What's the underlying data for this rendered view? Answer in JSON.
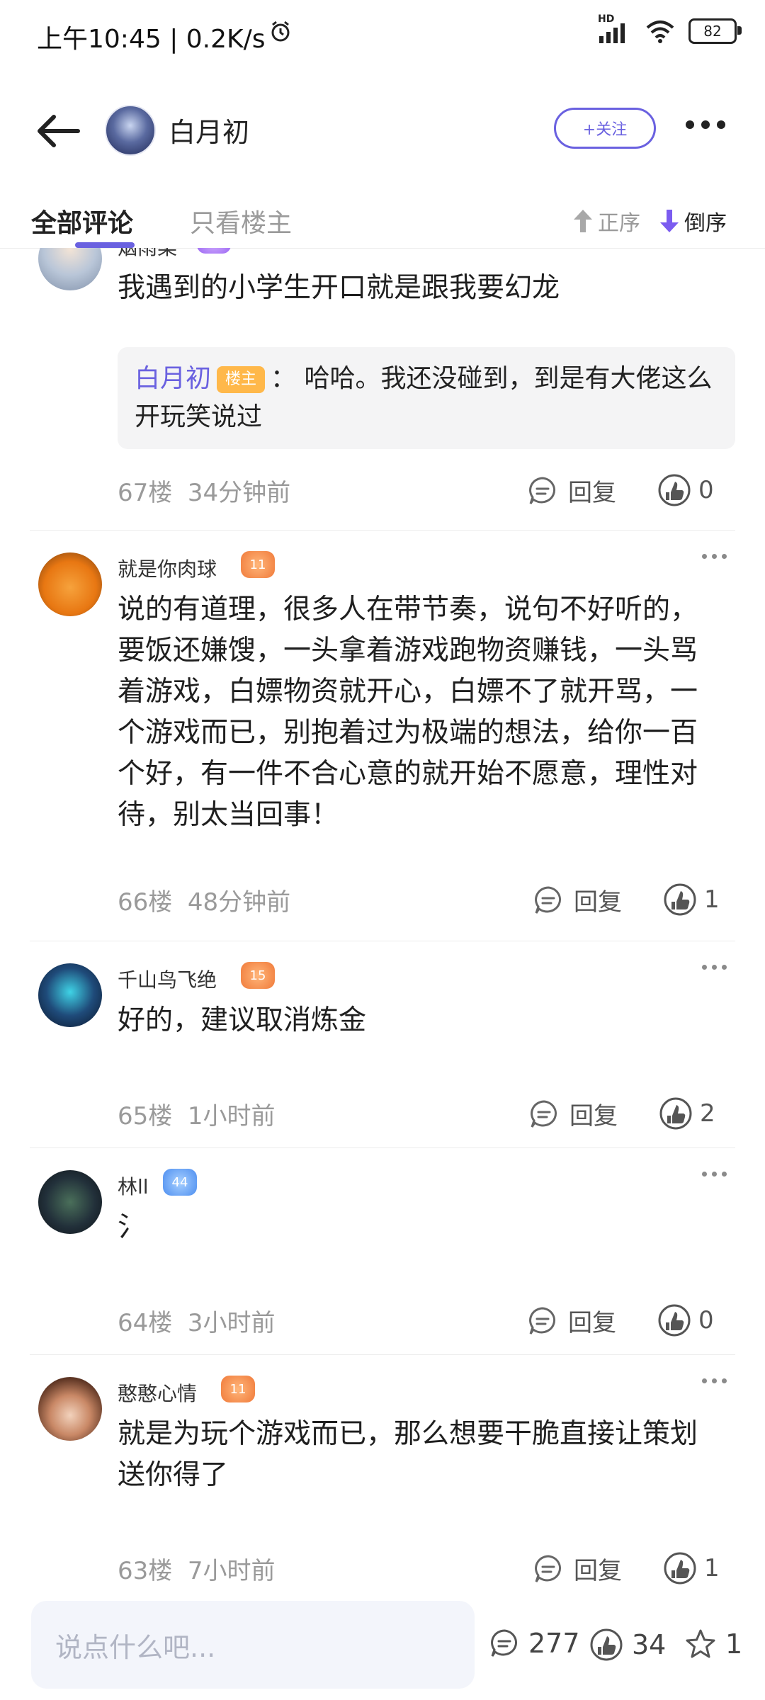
{
  "status_bar": {
    "time": "上午10:45 | 0.2K/s",
    "battery": "82",
    "network": "HD"
  },
  "header": {
    "username": "白月初",
    "follow_label": "+关注"
  },
  "tabs": {
    "all": "全部评论",
    "owner_only": "只看楼主",
    "sort_asc": "正序",
    "sort_desc": "倒序"
  },
  "comments": [
    {
      "username": "烟雨柔",
      "badge": "",
      "text": "我遇到的小学生开口就是跟我要幻龙",
      "reply": {
        "user": "白月初",
        "tag": "楼主",
        "text": "：  哈哈。我还没碰到，到是有大佬这么开玩笑说过"
      },
      "floor": "67楼",
      "time": "34分钟前",
      "reply_label": "回复",
      "likes": "0"
    },
    {
      "username": "就是你肉球",
      "badge": "11",
      "text": "说的有道理，很多人在带节奏，说句不好听的，要饭还嫌馊，一头拿着游戏跑物资赚钱，一头骂着游戏，白嫖物资就开心，白嫖不了就开骂，一个游戏而已，别抱着过为极端的想法，给你一百个好，有一件不合心意的就开始不愿意，理性对待，别太当回事！",
      "floor": "66楼",
      "time": "48分钟前",
      "reply_label": "回复",
      "likes": "1"
    },
    {
      "username": "千山鸟飞绝",
      "badge": "15",
      "text": "好的，建议取消炼金",
      "floor": "65楼",
      "time": "1小时前",
      "reply_label": "回复",
      "likes": "2"
    },
    {
      "username": "林ll",
      "badge": "44",
      "text": "氵",
      "floor": "64楼",
      "time": "3小时前",
      "reply_label": "回复",
      "likes": "0"
    },
    {
      "username": "憨憨心情",
      "badge": "11",
      "text": "就是为玩个游戏而已，那么想要干脆直接让策划送你得了",
      "floor": "63楼",
      "time": "7小时前",
      "reply_label": "回复",
      "likes": "1"
    }
  ],
  "bottom_bar": {
    "placeholder": "说点什么吧...",
    "comments_count": "277",
    "likes_count": "34",
    "stars_count": "1"
  },
  "colors": {
    "accent": "#6a61e0",
    "owner_tag": "#ffb84a",
    "muted": "#9a9a9a"
  }
}
